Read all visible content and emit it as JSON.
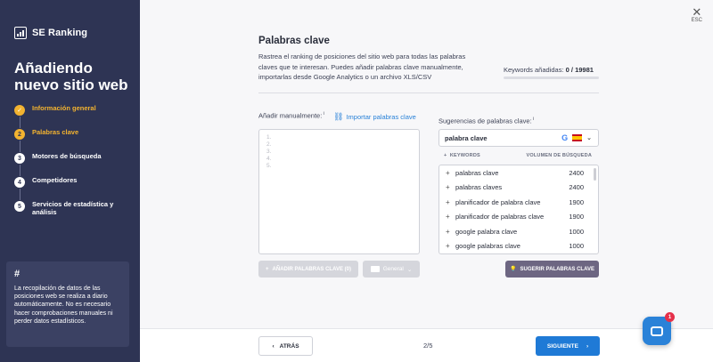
{
  "sidebar": {
    "logo_text": "SE Ranking",
    "title": "Añadiendo nuevo sitio web",
    "steps": [
      {
        "num": "✓",
        "label": "Información general",
        "state": "done"
      },
      {
        "num": "2",
        "label": "Palabras clave",
        "state": "active"
      },
      {
        "num": "3",
        "label": "Motores de búsqueda",
        "state": "pending"
      },
      {
        "num": "4",
        "label": "Competidores",
        "state": "pending"
      },
      {
        "num": "5",
        "label": "Servicios de estadística y análisis",
        "state": "pending"
      }
    ],
    "info": {
      "hash": "#",
      "text": "La recopilación de datos de las posiciones web se realiza a diario automáticamente. No es necesario hacer comprobaciones manuales ni perder datos estadísticos."
    }
  },
  "close": {
    "esc": "ESC"
  },
  "main": {
    "title": "Palabras clave",
    "description": "Rastrea el ranking de posiciones del sitio web para todas las palabras claves que te interesan. Puedes añadir palabras clave manualmente, importarlas desde Google Analytics o un archivo XLS/CSV",
    "keywords_added_label": "Keywords añadidas:",
    "keywords_added_value": "0",
    "keywords_limit": "/ 19981",
    "keywords_progress": 0
  },
  "manual": {
    "label": "Añadir manualmente:",
    "import_link": "Importar palabras clave",
    "line_numbers": [
      "1.",
      "2.",
      "3.",
      "4.",
      "5."
    ],
    "add_button": "AÑADIR PALABRAS CLAVE (0)",
    "folder": "General"
  },
  "suggestions": {
    "label": "Sugerencias de palabras clave:",
    "query": "palabra clave",
    "col_keywords": "KEYWORDS",
    "col_volume": "VOLUMEN DE BÚSQUEDA",
    "rows": [
      {
        "kw": "palabras clave",
        "vol": "2400"
      },
      {
        "kw": "palabras claves",
        "vol": "2400"
      },
      {
        "kw": "planificador de palabra clave",
        "vol": "1900"
      },
      {
        "kw": "planificador de palabras clave",
        "vol": "1900"
      },
      {
        "kw": "google palabra clave",
        "vol": "1000"
      },
      {
        "kw": "google palabras clave",
        "vol": "1000"
      }
    ],
    "suggest_button": "SUGERIR PALABRAS CLAVE"
  },
  "footer": {
    "back": "ATRÁS",
    "pager": "2/5",
    "next": "SIGUIENTE"
  },
  "chat": {
    "badge": "1"
  }
}
